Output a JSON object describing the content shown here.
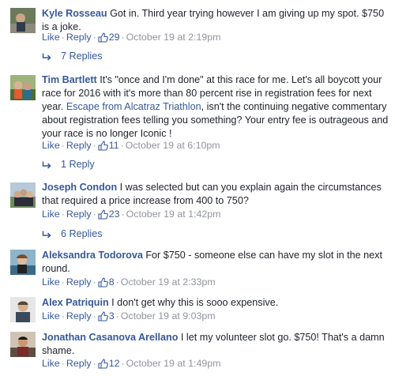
{
  "comments": [
    {
      "author": "Kyle Rosseau",
      "text": " Got in. Third year trying however I am giving up my spot. $750 is a joke.",
      "like": "Like",
      "reply": "Reply",
      "likes": "29",
      "time": "October 19 at 2:19pm",
      "replies": "7 Replies"
    },
    {
      "author": "Tim Bartlett",
      "text_before": " It's \"once and I'm done\" at this race for me. Let's all boycott your race for 2016 with it's more than 80 percent rise in registration fees for next year. ",
      "mention": "Escape from Alcatraz Triathlon",
      "text_after": ", isn't the continuing negative commentary about registration fees telling you something? Your entry fee is outrageous and your race is no longer Iconic !",
      "like": "Like",
      "reply": "Reply",
      "likes": "11",
      "time": "October 19 at 6:10pm",
      "replies": "1 Reply"
    },
    {
      "author": "Joseph Condon",
      "text": " I was selected but can you explain again the circumstances that required a price increase from 400 to 750?",
      "like": "Like",
      "reply": "Reply",
      "likes": "23",
      "time": "October 19 at 1:42pm",
      "replies": "6 Replies"
    },
    {
      "author": "Aleksandra Todorova",
      "text": " For $750 - someone else can have my slot in the next round.",
      "like": "Like",
      "reply": "Reply",
      "likes": "8",
      "time": "October 19 at 2:33pm"
    },
    {
      "author": "Alex Patriquin",
      "text": " I don't get why this is sooo expensive.",
      "like": "Like",
      "reply": "Reply",
      "likes": "3",
      "time": "October 19 at 9:03pm"
    },
    {
      "author": "Jonathan Casanova Arellano",
      "text": " I let my volunteer slot go. $750! That's a damn shame.",
      "like": "Like",
      "reply": "Reply",
      "likes": "12",
      "time": "October 19 at 1:49pm"
    }
  ],
  "colors": {
    "link": "#365899",
    "meta": "#90949c",
    "text": "#1d2129"
  },
  "icons": {
    "like": "thumbs-up-icon",
    "reply": "reply-arrow-icon"
  }
}
